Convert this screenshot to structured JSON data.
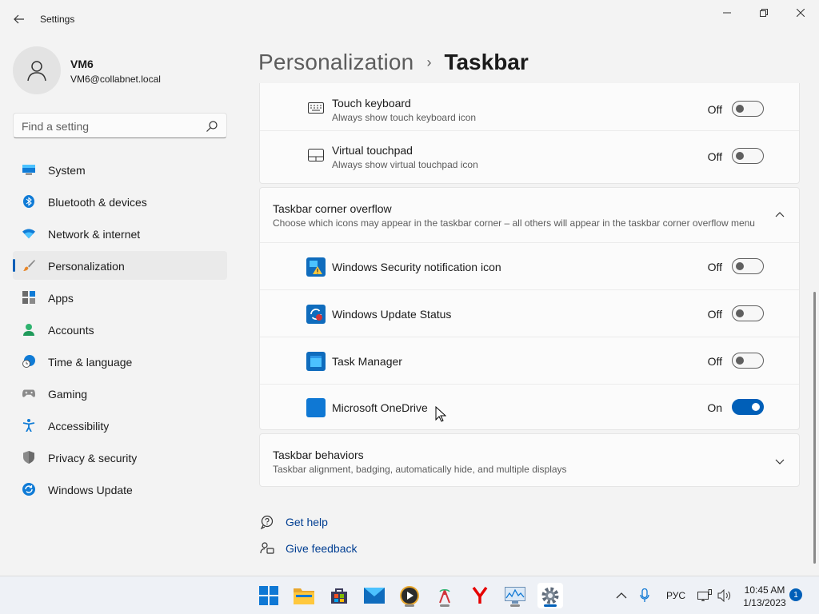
{
  "app": {
    "title": "Settings"
  },
  "user": {
    "name": "VM6",
    "email": "VM6@collabnet.local"
  },
  "search": {
    "placeholder": "Find a setting"
  },
  "sidebar": {
    "items": [
      {
        "label": "System",
        "icon": "monitor-icon"
      },
      {
        "label": "Bluetooth & devices",
        "icon": "bluetooth-icon"
      },
      {
        "label": "Network & internet",
        "icon": "wifi-icon"
      },
      {
        "label": "Personalization",
        "icon": "brush-icon",
        "active": true
      },
      {
        "label": "Apps",
        "icon": "apps-icon"
      },
      {
        "label": "Accounts",
        "icon": "person-icon"
      },
      {
        "label": "Time & language",
        "icon": "globe-clock-icon"
      },
      {
        "label": "Gaming",
        "icon": "gamepad-icon"
      },
      {
        "label": "Accessibility",
        "icon": "accessibility-icon"
      },
      {
        "label": "Privacy & security",
        "icon": "shield-icon"
      },
      {
        "label": "Windows Update",
        "icon": "update-icon"
      }
    ]
  },
  "breadcrumb": {
    "parent": "Personalization",
    "separator": "›",
    "current": "Taskbar"
  },
  "pen_touch": {
    "items": [
      {
        "title": "Touch keyboard",
        "desc": "Always show touch keyboard icon",
        "state": "Off",
        "on": false,
        "icon": "keyboard-icon"
      },
      {
        "title": "Virtual touchpad",
        "desc": "Always show virtual touchpad icon",
        "state": "Off",
        "on": false,
        "icon": "touchpad-icon"
      }
    ]
  },
  "overflow": {
    "title": "Taskbar corner overflow",
    "desc": "Choose which icons may appear in the taskbar corner – all others will appear in the taskbar corner overflow menu",
    "expanded": true,
    "items": [
      {
        "title": "Windows Security notification icon",
        "state": "Off",
        "on": false,
        "icon": "security-warning-icon"
      },
      {
        "title": "Windows Update Status",
        "state": "Off",
        "on": false,
        "icon": "update-status-icon"
      },
      {
        "title": "Task Manager",
        "state": "Off",
        "on": false,
        "icon": "task-manager-icon"
      },
      {
        "title": "Microsoft OneDrive",
        "state": "On",
        "on": true,
        "icon": "onedrive-icon"
      }
    ]
  },
  "behaviors": {
    "title": "Taskbar behaviors",
    "desc": "Taskbar alignment, badging, automatically hide, and multiple displays"
  },
  "help": {
    "get_help": "Get help",
    "give_feedback": "Give feedback"
  },
  "taskbar": {
    "lang": "РУС",
    "time": "10:45 AM",
    "date": "1/13/2023",
    "notifications": "1"
  },
  "colors": {
    "accent": "#005fb8",
    "link": "#003e92",
    "background": "#f3f3f3",
    "card": "#fbfbfb"
  }
}
